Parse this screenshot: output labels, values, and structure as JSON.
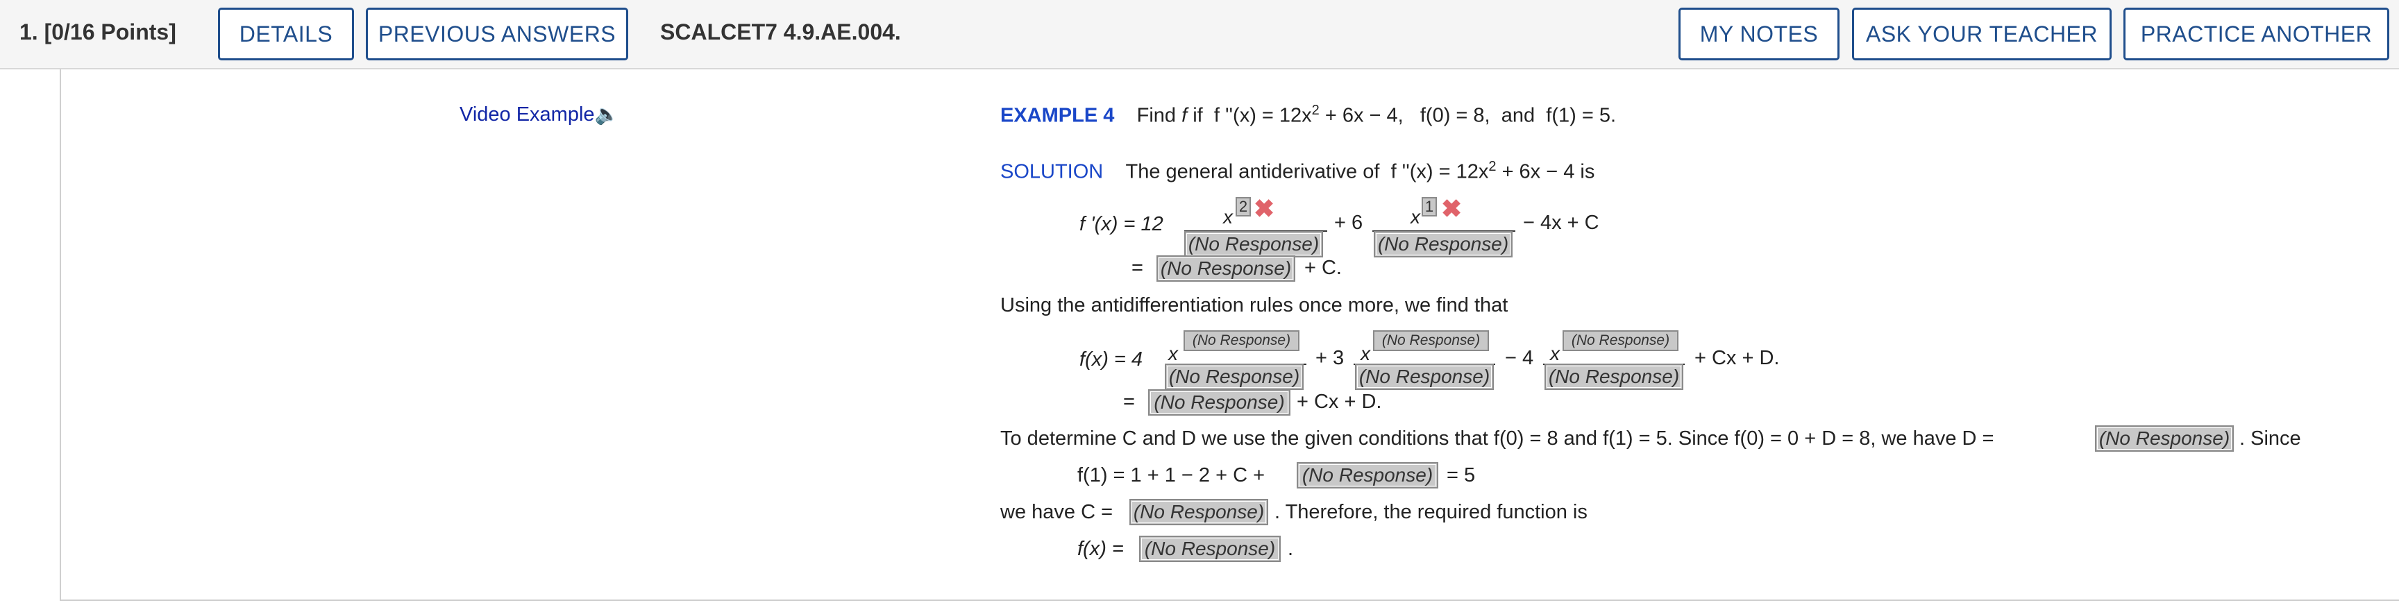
{
  "header": {
    "points": "1. [0/16 Points]",
    "details_label": "DETAILS",
    "previous_answers_label": "PREVIOUS ANSWERS",
    "problem_code": "SCALCET7 4.9.AE.004.",
    "my_notes_label": "MY NOTES",
    "ask_teacher_label": "ASK YOUR TEACHER",
    "practice_another_label": "PRACTICE ANOTHER"
  },
  "video_link": "Video Example",
  "example": {
    "label": "EXAMPLE 4",
    "statement_find": "Find",
    "statement_f": "f",
    "statement_if": "if",
    "statement_given": "f ''(x) = 12x",
    "statement_sup": "2",
    "statement_rest": "+ 6x − 4,",
    "f0": "f(0) = 8,",
    "and": "and",
    "f1": "f(1) = 5."
  },
  "solution": {
    "label": "SOLUTION",
    "text": "The general antiderivative of",
    "expr": "f ''(x) = 12x",
    "sup": "2",
    "expr_rest": "+ 6x − 4  is"
  },
  "fprime": {
    "lhs": "f '(x)  =  12",
    "plus6": "+ 6",
    "tail": "− 4x + C",
    "x": "x",
    "exp1": "2",
    "exp2": "1",
    "eq": "=",
    "plusC": "+ C."
  },
  "using_text": "Using the antidifferentiation rules once more, we find that",
  "fx": {
    "lhs": "f(x)  =  4",
    "plus3": "+ 3",
    "minus4": "− 4",
    "tail": "+ Cx + D.",
    "x": "x",
    "eq": "=",
    "tail2": "+ Cx + D."
  },
  "determine": {
    "line1": "To determine C and D we use the given conditions that  f(0) = 8  and  f(1) = 5.  Since  f(0) = 0 + D = 8,  we have  D =",
    "since": ".  Since",
    "line2_pre": "f(1) = 1 + 1 − 2 + C +",
    "line2_post": "= 5",
    "line3_pre": "we have  C =",
    "line3_post": ".  Therefore, the required function is",
    "line4_pre": "f(x)  =",
    "line4_post": "."
  },
  "no_response": "(No Response)"
}
